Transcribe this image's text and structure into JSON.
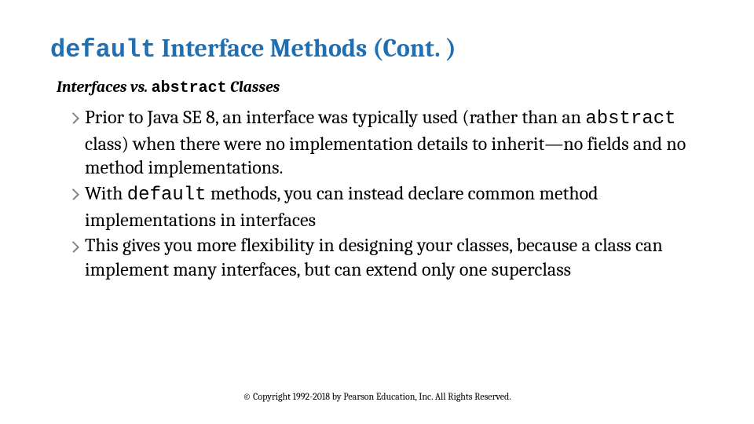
{
  "title": {
    "code_prefix": "default",
    "rest": " Interface Methods (Cont. )"
  },
  "subheading": {
    "before": "Interfaces vs. ",
    "code": "abstract",
    "after": " Classes"
  },
  "bullets": [
    {
      "pre": "Prior to Java SE 8, an interface was typically used (rather than an ",
      "code": "abstract",
      "post": " class) when there were no implementation details to inherit—no fields and no method implementations."
    },
    {
      "pre": "With ",
      "code": "default",
      "post": " methods, you can instead declare common method implementations in interfaces"
    },
    {
      "pre": "This gives you more flexibility in designing your classes, because a class can implement many interfaces, but can extend only one superclass",
      "code": "",
      "post": ""
    }
  ],
  "footer": "© Copyright 1992-2018 by Pearson Education, Inc. All Rights Reserved."
}
